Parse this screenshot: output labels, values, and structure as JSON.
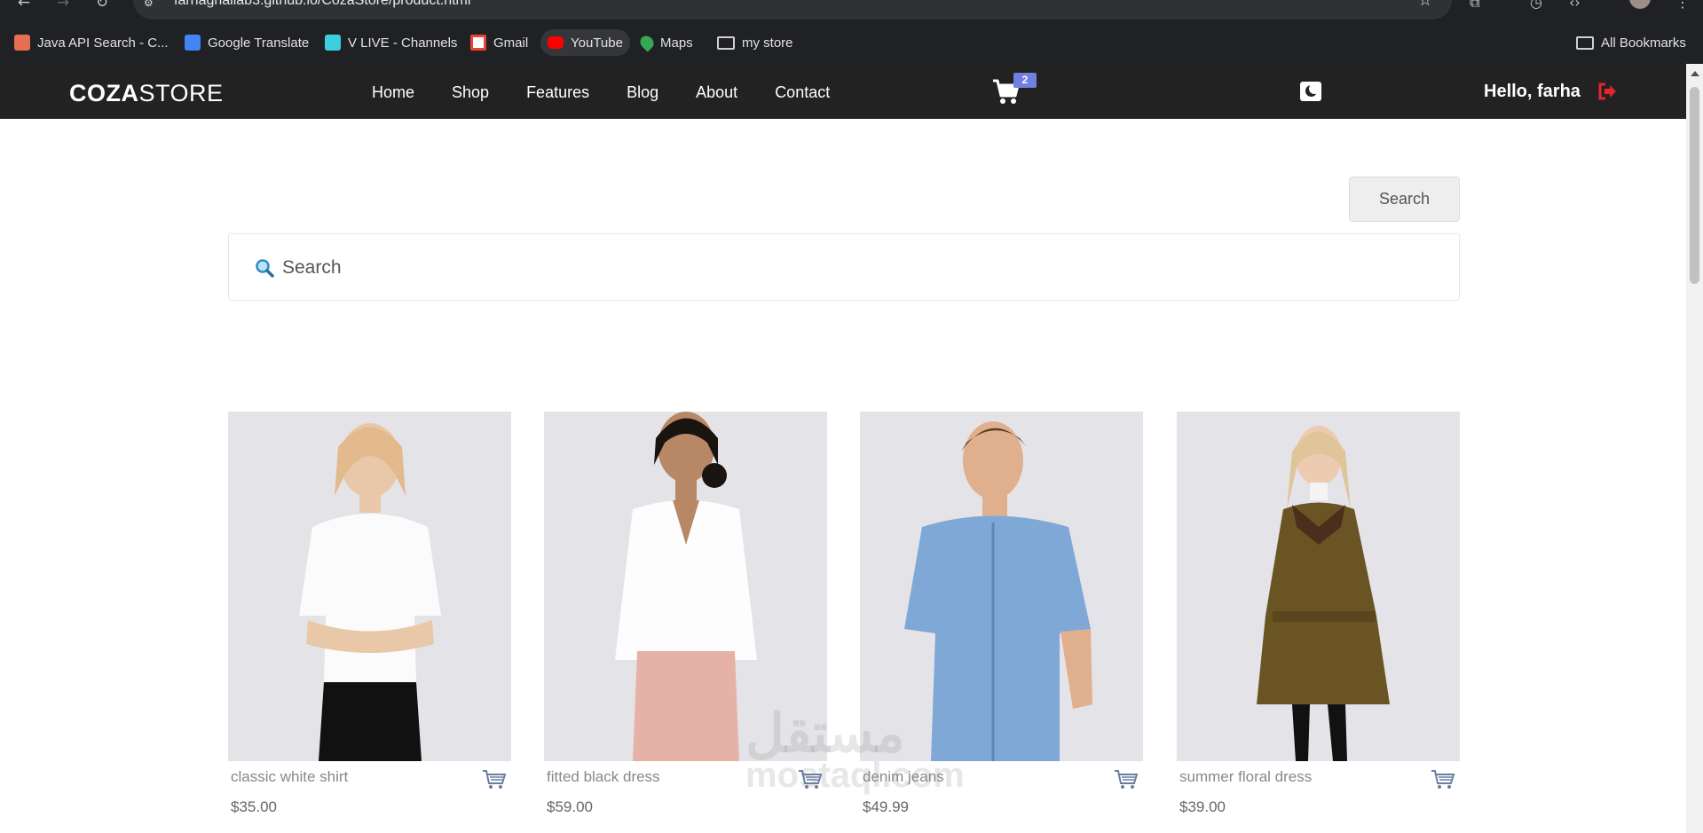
{
  "browser": {
    "url": "farhaghallab3.github.io/CozaStore/product.html",
    "bookmarks": [
      {
        "label": "Java API Search - C...",
        "icon": "java-icon",
        "color": "#e76f51"
      },
      {
        "label": "Google Translate",
        "icon": "translate-icon",
        "color": "#4285f4"
      },
      {
        "label": "V LIVE - Channels",
        "icon": "vlive-icon",
        "color": "#3ccfe0"
      },
      {
        "label": "Gmail",
        "icon": "gmail-icon",
        "color": "#ea4335"
      },
      {
        "label": "YouTube",
        "icon": "youtube-icon",
        "color": "#ff0000"
      },
      {
        "label": "Maps",
        "icon": "maps-icon",
        "color": "#34a853"
      },
      {
        "label": "my store",
        "icon": "folder-icon",
        "color": "#d0d0d0"
      }
    ],
    "all_bookmarks": "All Bookmarks"
  },
  "header": {
    "logo_bold": "COZA",
    "logo_rest": "STORE",
    "nav": [
      "Home",
      "Shop",
      "Features",
      "Blog",
      "About",
      "Contact"
    ],
    "cart_count": "2",
    "greeting": "Hello, farha",
    "accent": "#717fe0",
    "logout_color": "#e3262c"
  },
  "search": {
    "button_label": "Search",
    "placeholder": "Search"
  },
  "products": [
    {
      "name": "classic white shirt",
      "price": "$35.00"
    },
    {
      "name": "fitted black dress",
      "price": "$59.00"
    },
    {
      "name": "denim jeans",
      "price": "$49.99"
    },
    {
      "name": "summer floral dress",
      "price": "$39.00"
    }
  ],
  "watermark": {
    "arabic": "مستقل",
    "latin": "mostaql.com"
  }
}
